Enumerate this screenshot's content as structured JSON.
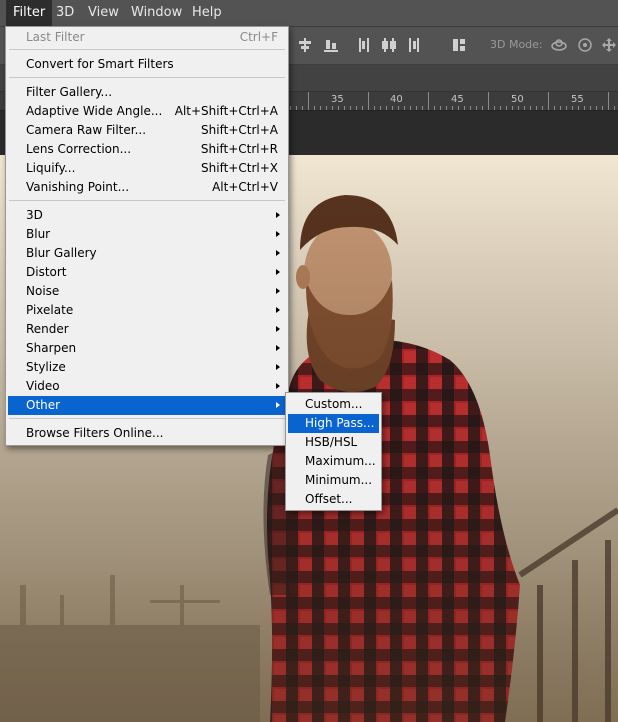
{
  "menubar": {
    "items": [
      {
        "label": "Filter",
        "active": true
      },
      {
        "label": "3D",
        "active": false
      },
      {
        "label": "View",
        "active": false
      },
      {
        "label": "Window",
        "active": false
      },
      {
        "label": "Help",
        "active": false
      }
    ]
  },
  "optionsbar": {
    "mode_label": "3D Mode:"
  },
  "ruler": {
    "labels": [
      "35",
      "40",
      "45",
      "50",
      "55"
    ]
  },
  "filter_menu": {
    "items": [
      {
        "label": "Last Filter",
        "shortcut": "Ctrl+F",
        "disabled": true
      },
      {
        "label": "Convert for Smart Filters",
        "shortcut": ""
      },
      {
        "label": "Filter Gallery...",
        "shortcut": ""
      },
      {
        "label": "Adaptive Wide Angle...",
        "shortcut": "Alt+Shift+Ctrl+A"
      },
      {
        "label": "Camera Raw Filter...",
        "shortcut": "Shift+Ctrl+A"
      },
      {
        "label": "Lens Correction...",
        "shortcut": "Shift+Ctrl+R"
      },
      {
        "label": "Liquify...",
        "shortcut": "Shift+Ctrl+X"
      },
      {
        "label": "Vanishing Point...",
        "shortcut": "Alt+Ctrl+V"
      },
      {
        "label": "3D",
        "submenu": true
      },
      {
        "label": "Blur",
        "submenu": true
      },
      {
        "label": "Blur Gallery",
        "submenu": true
      },
      {
        "label": "Distort",
        "submenu": true
      },
      {
        "label": "Noise",
        "submenu": true
      },
      {
        "label": "Pixelate",
        "submenu": true
      },
      {
        "label": "Render",
        "submenu": true
      },
      {
        "label": "Sharpen",
        "submenu": true
      },
      {
        "label": "Stylize",
        "submenu": true
      },
      {
        "label": "Video",
        "submenu": true
      },
      {
        "label": "Other",
        "submenu": true,
        "highlighted": true
      },
      {
        "label": "Browse Filters Online...",
        "shortcut": ""
      }
    ]
  },
  "other_submenu": {
    "items": [
      {
        "label": "Custom...",
        "highlighted": false
      },
      {
        "label": "High Pass...",
        "highlighted": true
      },
      {
        "label": "HSB/HSL",
        "highlighted": false
      },
      {
        "label": "Maximum...",
        "highlighted": false
      },
      {
        "label": "Minimum...",
        "highlighted": false
      },
      {
        "label": "Offset...",
        "highlighted": false
      }
    ]
  },
  "colors": {
    "menu_highlight": "#0a64d0",
    "menubar_bg": "#535353",
    "menu_bg": "#f0f0f0"
  }
}
